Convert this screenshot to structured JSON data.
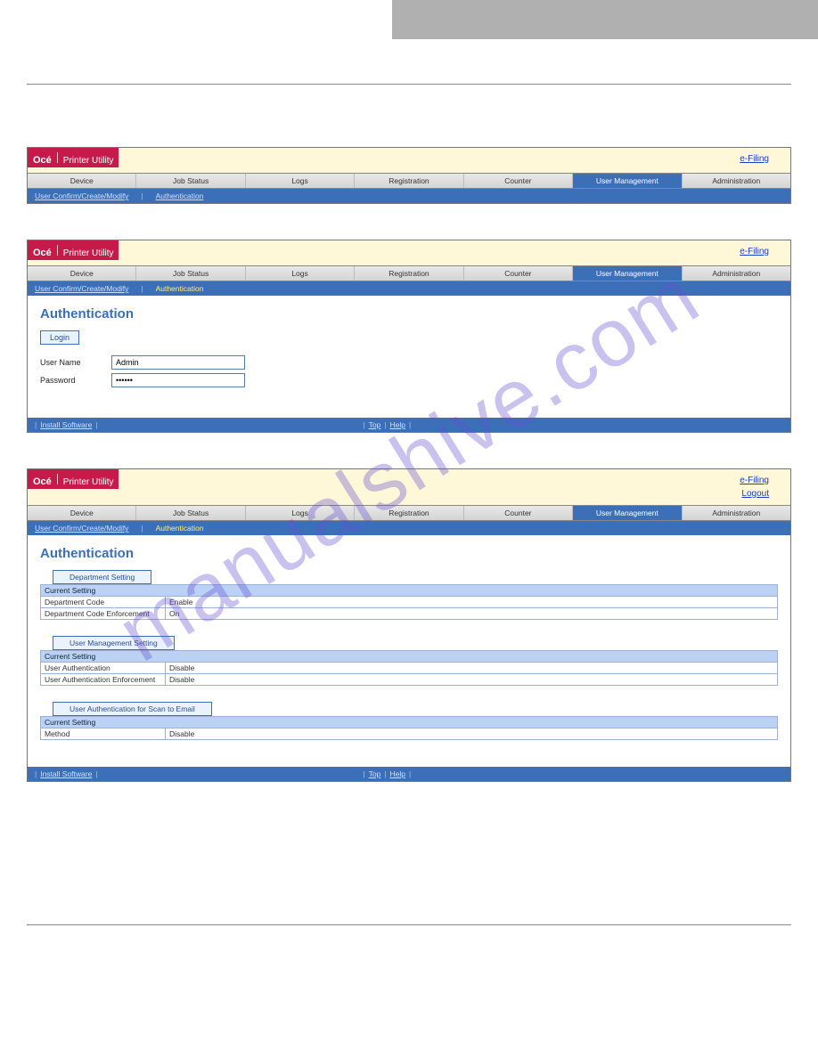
{
  "watermark": "manualshive.com",
  "nav_tabs": [
    "Device",
    "Job Status",
    "Logs",
    "Registration",
    "Counter",
    "User Management",
    "Administration"
  ],
  "logo": {
    "brand": "Océ",
    "product": "Printer Utility"
  },
  "links": {
    "efiling": "e-Filing",
    "logout": "Logout",
    "install": "Install Software",
    "top": "Top",
    "help": "Help"
  },
  "subnav": {
    "confirm": "User Confirm/Create/Modify",
    "auth": "Authentication"
  },
  "shot2": {
    "title": "Authentication",
    "login_btn": "Login",
    "user_label": "User Name",
    "user_value": "Admin",
    "pass_label": "Password",
    "pass_value": "••••••"
  },
  "shot3": {
    "title": "Authentication",
    "blocks": [
      {
        "button": "Department Setting",
        "rows": [
          {
            "hdr": "Current Setting"
          },
          {
            "k": "Department Code",
            "v": "Enable"
          },
          {
            "k": "Department Code Enforcement",
            "v": "On"
          }
        ]
      },
      {
        "button": "User Management Setting",
        "rows": [
          {
            "hdr": "Current Setting"
          },
          {
            "k": "User Authentication",
            "v": "Disable"
          },
          {
            "k": "User Authentication Enforcement",
            "v": "Disable"
          }
        ]
      },
      {
        "button": "User Authentication for Scan to Email",
        "rows": [
          {
            "hdr": "Current Setting"
          },
          {
            "k": "Method",
            "v": "Disable"
          }
        ]
      }
    ]
  }
}
